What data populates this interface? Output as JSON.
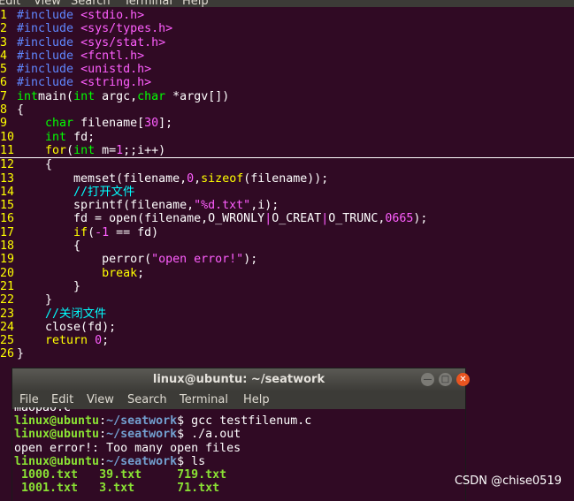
{
  "top_menu": {
    "edit": "Edit",
    "view": "View",
    "search": "Search",
    "terminal": "Terminal",
    "help": "Help"
  },
  "code_lines": [
    {
      "n": "1",
      "segs": [
        [
          "pp",
          "#include "
        ],
        [
          "hd",
          "<stdio.h>"
        ]
      ]
    },
    {
      "n": "2",
      "segs": [
        [
          "pp",
          "#include "
        ],
        [
          "hd",
          "<sys/types.h>"
        ]
      ]
    },
    {
      "n": "3",
      "segs": [
        [
          "pp",
          "#include "
        ],
        [
          "hd",
          "<sys/stat.h>"
        ]
      ]
    },
    {
      "n": "4",
      "segs": [
        [
          "pp",
          "#include "
        ],
        [
          "hd",
          "<fcntl.h>"
        ]
      ]
    },
    {
      "n": "5",
      "segs": [
        [
          "pp",
          "#include "
        ],
        [
          "hd",
          "<unistd.h>"
        ]
      ]
    },
    {
      "n": "6",
      "segs": [
        [
          "pp",
          "#include "
        ],
        [
          "hd",
          "<string.h>"
        ]
      ]
    },
    {
      "n": "7",
      "segs": [
        [
          "kw",
          "int"
        ],
        [
          "",
          "main("
        ],
        [
          "kw",
          "int"
        ],
        [
          "",
          " argc,"
        ],
        [
          "kw",
          "char"
        ],
        [
          "",
          " *argv[])"
        ]
      ]
    },
    {
      "n": "8",
      "segs": [
        [
          "",
          "{"
        ]
      ]
    },
    {
      "n": "9",
      "segs": [
        [
          "",
          "    "
        ],
        [
          "kw",
          "char"
        ],
        [
          "",
          " filename["
        ],
        [
          "num",
          "30"
        ],
        [
          "",
          "];"
        ]
      ]
    },
    {
      "n": "10",
      "segs": [
        [
          "",
          "    "
        ],
        [
          "kw",
          "int"
        ],
        [
          "",
          " fd;"
        ]
      ]
    },
    {
      "n": "11",
      "segs": [
        [
          "",
          "    "
        ],
        [
          "yl",
          "for"
        ],
        [
          "",
          "("
        ],
        [
          "kw",
          "int"
        ],
        [
          "",
          " m="
        ],
        [
          "num",
          "1"
        ],
        [
          "",
          ";;i++)"
        ]
      ],
      "cursor": true
    },
    {
      "n": "12",
      "segs": [
        [
          "",
          "    {"
        ]
      ]
    },
    {
      "n": "13",
      "segs": [
        [
          "",
          "        memset(filename,"
        ],
        [
          "num",
          "0"
        ],
        [
          "",
          ","
        ],
        [
          "yl",
          "sizeof"
        ],
        [
          "",
          "(filename));"
        ]
      ]
    },
    {
      "n": "14",
      "segs": [
        [
          "",
          "        "
        ],
        [
          "cm",
          "//打开文件"
        ]
      ]
    },
    {
      "n": "15",
      "segs": [
        [
          "",
          "        sprintf(filename,"
        ],
        [
          "str",
          "\"%d.txt\""
        ],
        [
          "",
          ",i);"
        ]
      ]
    },
    {
      "n": "16",
      "segs": [
        [
          "",
          "        fd = open(filename,O_WRONLY"
        ],
        [
          "str",
          "|"
        ],
        [
          "",
          "O_CREAT"
        ],
        [
          "str",
          "|"
        ],
        [
          "",
          "O_TRUNC,"
        ],
        [
          "num",
          "0665"
        ],
        [
          "",
          ");"
        ]
      ]
    },
    {
      "n": "17",
      "segs": [
        [
          "",
          "        "
        ],
        [
          "yl",
          "if"
        ],
        [
          "",
          "("
        ],
        [
          "num",
          "-1"
        ],
        [
          "",
          " == fd)"
        ]
      ]
    },
    {
      "n": "18",
      "segs": [
        [
          "",
          "        {"
        ]
      ]
    },
    {
      "n": "19",
      "segs": [
        [
          "",
          "            perror("
        ],
        [
          "str",
          "\"open error!\""
        ],
        [
          "",
          ");"
        ]
      ]
    },
    {
      "n": "20",
      "segs": [
        [
          "",
          "            "
        ],
        [
          "yl",
          "break"
        ],
        [
          "",
          ";"
        ]
      ]
    },
    {
      "n": "21",
      "segs": [
        [
          "",
          "        }"
        ]
      ]
    },
    {
      "n": "22",
      "segs": [
        [
          "",
          "    }"
        ]
      ]
    },
    {
      "n": "23",
      "segs": [
        [
          "",
          "    "
        ],
        [
          "cm",
          "//关闭文件"
        ]
      ]
    },
    {
      "n": "24",
      "segs": [
        [
          "",
          "    close(fd);"
        ]
      ]
    },
    {
      "n": "25",
      "segs": [
        [
          "",
          "    "
        ],
        [
          "yl",
          "return"
        ],
        [
          "",
          " "
        ],
        [
          "num",
          "0"
        ],
        [
          "",
          ";"
        ]
      ]
    },
    {
      "n": "26",
      "segs": [
        [
          "",
          "}"
        ]
      ]
    }
  ],
  "terminal": {
    "title": "linux@ubuntu: ~/seatwork",
    "menu": {
      "file": "File",
      "edit": "Edit",
      "view": "View",
      "search": "Search",
      "terminal": "Terminal",
      "help": "Help"
    },
    "lines": [
      {
        "segs": [
          [
            "",
            "maopao.c"
          ]
        ]
      },
      {
        "segs": [
          [
            "pu",
            "linux@ubuntu"
          ],
          [
            "",
            ":"
          ],
          [
            "pd",
            "~/seatwork"
          ],
          [
            "",
            "$ gcc testfilenum.c"
          ]
        ]
      },
      {
        "segs": [
          [
            "pu",
            "linux@ubuntu"
          ],
          [
            "",
            ":"
          ],
          [
            "pd",
            "~/seatwork"
          ],
          [
            "",
            "$ ./a.out"
          ]
        ]
      },
      {
        "segs": [
          [
            "",
            "open error!: Too many open files"
          ]
        ]
      },
      {
        "segs": [
          [
            "pu",
            "linux@ubuntu"
          ],
          [
            "",
            ":"
          ],
          [
            "pd",
            "~/seatwork"
          ],
          [
            "",
            "$ ls"
          ]
        ]
      },
      {
        "segs": [
          [
            "tf",
            " 1000.txt   39.txt     719.txt"
          ]
        ]
      },
      {
        "segs": [
          [
            "tf",
            " 1001.txt   3.txt      71.txt"
          ]
        ]
      }
    ]
  },
  "watermark": "CSDN @chise0519",
  "colors": {
    "terminal_bg": "#300a24",
    "keyword": "#00ff00",
    "string": "#ff5fff",
    "comment": "#00ffff",
    "preproc": "#5f87ff",
    "linenumber": "#ffff00",
    "prompt_user": "#8ae234",
    "prompt_dir": "#729fcf"
  }
}
